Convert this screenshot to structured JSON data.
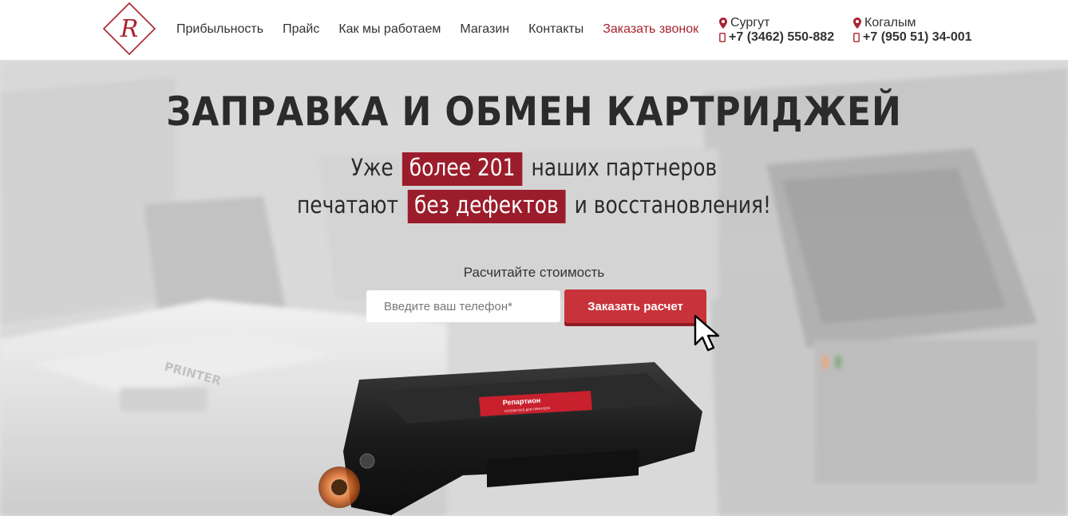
{
  "header": {
    "logo_letter": "R",
    "nav": [
      {
        "label": "Прибыльность"
      },
      {
        "label": "Прайс"
      },
      {
        "label": "Как мы работаем"
      },
      {
        "label": "Магазин"
      },
      {
        "label": "Контакты"
      },
      {
        "label": "Заказать звонок"
      }
    ],
    "contacts": [
      {
        "city": "Сургут",
        "phone": "+7 (3462) 550-882"
      },
      {
        "city": "Когалым",
        "phone": "+7 (950 51) 34-001"
      }
    ],
    "accent_color": "#a8242f"
  },
  "hero": {
    "title": "ЗАПРАВКА И ОБМЕН КАРТРИДЖЕЙ",
    "line1_pre": "Уже",
    "line1_highlight": "более 201",
    "line1_post": "наших партнеров",
    "line2_pre": "печатают",
    "line2_highlight": "без дефектов",
    "line2_post": "и восстановления!",
    "highlight_color": "#9b1d2b",
    "background_printer_label": "PRINTER",
    "calc_label": "Расчитайте стоимость",
    "phone_placeholder": "Введите ваш телефон*",
    "order_button": "Заказать расчет",
    "cartridge_brand": "Репартион",
    "cartridge_tagline": "ОТСЕКИ ВСЕ ДЛЯ ПРИНТЕРА"
  }
}
